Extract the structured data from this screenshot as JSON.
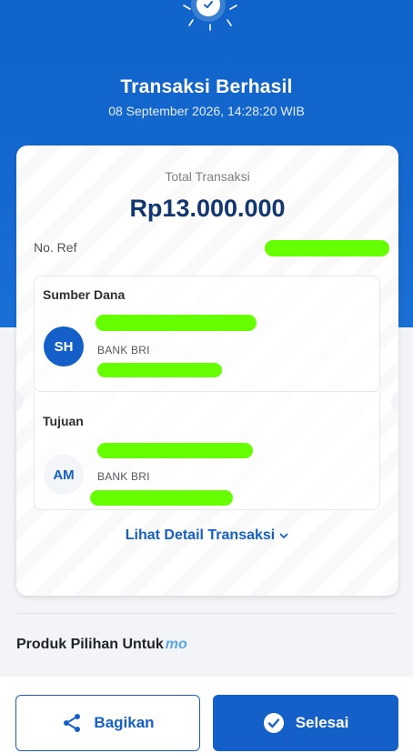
{
  "header": {
    "title": "Transaksi Berhasil",
    "datetime": "08 September 2026, 14:28:20 WIB"
  },
  "receipt": {
    "total_label": "Total Transaksi",
    "total_amount": "Rp13.000.000",
    "ref_label": "No. Ref",
    "source": {
      "title": "Sumber Dana",
      "initials": "SH",
      "bank": "BANK BRI"
    },
    "destination": {
      "title": "Tujuan",
      "initials": "AM",
      "bank": "BANK BRI"
    },
    "detail_link_label": "Lihat Detail Transaksi"
  },
  "recommendation": {
    "title": "Produk Pilihan Untuk",
    "brand": "mo"
  },
  "actions": {
    "share_label": "Bagikan",
    "done_label": "Selesai"
  },
  "icons": {
    "check": "check-icon",
    "share": "share-icon",
    "done": "check-circle-icon",
    "chevron": "chevron-down-icon"
  },
  "colors": {
    "primary": "#1560c8",
    "amount": "#12366e",
    "redaction": "#66ff00"
  }
}
